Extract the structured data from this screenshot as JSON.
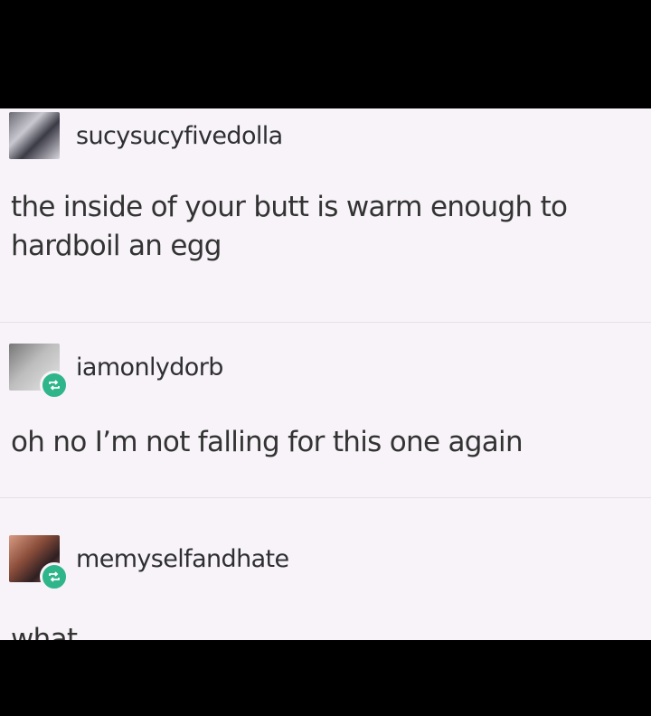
{
  "posts": [
    {
      "username": "sucysucyfivedolla",
      "text": "the inside of your butt is warm enough to hardboil an egg",
      "avatar_icon": "user-avatar",
      "reblog": false
    },
    {
      "username": "iamonlydorb",
      "text": "oh no I’m not falling for this one again",
      "avatar_icon": "user-avatar",
      "reblog": true
    },
    {
      "username": "memyselfandhate",
      "text": "what",
      "avatar_icon": "user-avatar",
      "reblog": true
    }
  ],
  "colors": {
    "background": "#f7f3f8",
    "letterbox": "#000000",
    "reblog_badge": "#2fb58a",
    "text": "#333333"
  }
}
